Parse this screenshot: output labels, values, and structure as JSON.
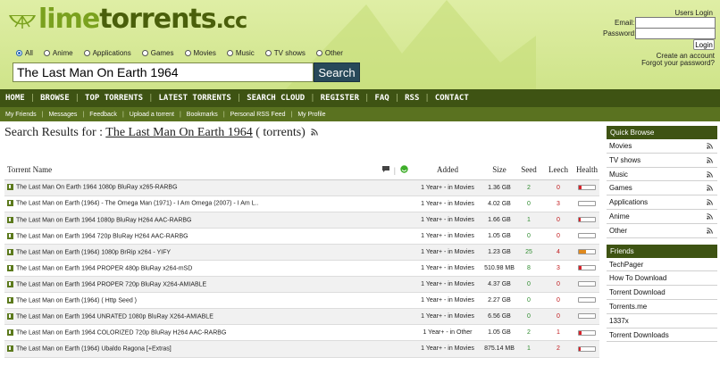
{
  "site": {
    "logo_lime": "lime",
    "logo_torrents": "torrents",
    "logo_tld": ".cc"
  },
  "colors": {
    "accent": "#3e5313",
    "header_bg": "#d9eb9c",
    "seed": "#2e8b2e",
    "leech": "#c0181b",
    "search_btn": "#28495a"
  },
  "categories": [
    {
      "label": "All",
      "checked": true
    },
    {
      "label": "Anime",
      "checked": false
    },
    {
      "label": "Applications",
      "checked": false
    },
    {
      "label": "Games",
      "checked": false
    },
    {
      "label": "Movies",
      "checked": false
    },
    {
      "label": "Music",
      "checked": false
    },
    {
      "label": "TV shows",
      "checked": false
    },
    {
      "label": "Other",
      "checked": false
    }
  ],
  "search": {
    "value": "The Last Man On Earth 1964",
    "button": "Search"
  },
  "login": {
    "users_login": "Users Login",
    "email_label": "Email:",
    "password_label": "Password:",
    "button": "Login",
    "create_account": "Create an account",
    "forgot": "Forgot your password?"
  },
  "nav": [
    "HOME",
    "BROWSE",
    "TOP TORRENTS",
    "LATEST TORRENTS",
    "SEARCH CLOUD",
    "REGISTER",
    "FAQ",
    "RSS",
    "CONTACT"
  ],
  "subnav": [
    "My Friends",
    "Messages",
    "Feedback",
    "Upload a torrent",
    "Bookmarks",
    "Personal RSS Feed",
    "My Profile"
  ],
  "results": {
    "prefix": "Search Results for : ",
    "query": "The Last Man On Earth 1964",
    "suffix": " ( torrents)"
  },
  "table": {
    "headers": {
      "name": "Torrent Name",
      "added": "Added",
      "size": "Size",
      "seed": "Seed",
      "leech": "Leech",
      "health": "Health"
    },
    "rows": [
      {
        "name": "The Last Man On Earth 1964 1080p BluRay x265-RARBG",
        "added": "1 Year+ - in Movies",
        "size": "1.36 GB",
        "seed": "2",
        "leech": "0",
        "health": 0.15,
        "health_color": "#d9232b"
      },
      {
        "name": "The Last Man on Earth (1964) - The Omega Man (1971) - I Am Omega (2007) - I Am L..",
        "added": "1 Year+ - in Movies",
        "size": "4.02 GB",
        "seed": "0",
        "leech": "3",
        "health": 0,
        "health_color": "#d9232b"
      },
      {
        "name": "The Last Man on Earth 1964 1080p BluRay H264 AAC-RARBG",
        "added": "1 Year+ - in Movies",
        "size": "1.66 GB",
        "seed": "1",
        "leech": "0",
        "health": 0.1,
        "health_color": "#d9232b"
      },
      {
        "name": "The Last Man on Earth 1964 720p BluRay H264 AAC-RARBG",
        "added": "1 Year+ - in Movies",
        "size": "1.05 GB",
        "seed": "0",
        "leech": "0",
        "health": 0,
        "health_color": "#d9232b"
      },
      {
        "name": "The Last Man on Earth (1964) 1080p BrRip x264 - YIFY",
        "added": "1 Year+ - in Movies",
        "size": "1.23 GB",
        "seed": "25",
        "leech": "4",
        "health": 0.45,
        "health_color": "#e08a1e"
      },
      {
        "name": "The Last Man on Earth 1964 PROPER 480p BluRay x264-mSD",
        "added": "1 Year+ - in Movies",
        "size": "510.98 MB",
        "seed": "8",
        "leech": "3",
        "health": 0.15,
        "health_color": "#d9232b"
      },
      {
        "name": "The Last Man on Earth 1964 PROPER 720p BluRay X264-AMIABLE",
        "added": "1 Year+ - in Movies",
        "size": "4.37 GB",
        "seed": "0",
        "leech": "0",
        "health": 0,
        "health_color": "#d9232b"
      },
      {
        "name": "The Last Man on Earth (1964) ( Http Seed )",
        "added": "1 Year+ - in Movies",
        "size": "2.27 GB",
        "seed": "0",
        "leech": "0",
        "health": 0,
        "health_color": "#d9232b"
      },
      {
        "name": "The Last Man on Earth 1964 UNRATED 1080p BluRay X264-AMIABLE",
        "added": "1 Year+ - in Movies",
        "size": "6.56 GB",
        "seed": "0",
        "leech": "0",
        "health": 0,
        "health_color": "#d9232b"
      },
      {
        "name": "The Last Man on Earth 1964 COLORIZED 720p BluRay H264 AAC-RARBG",
        "added": "1 Year+ - in Other",
        "size": "1.05 GB",
        "seed": "2",
        "leech": "1",
        "health": 0.15,
        "health_color": "#d9232b"
      },
      {
        "name": "The Last Man on Earth (1964) Ubaldo Ragona [+Extras]",
        "added": "1 Year+ - in Movies",
        "size": "875.14 MB",
        "seed": "1",
        "leech": "2",
        "health": 0.1,
        "health_color": "#d9232b"
      }
    ]
  },
  "quick_browse": {
    "title": "Quick Browse",
    "items": [
      "Movies",
      "TV shows",
      "Music",
      "Games",
      "Applications",
      "Anime",
      "Other"
    ]
  },
  "friends": {
    "title": "Friends",
    "items": [
      "TechPager",
      "How To Download",
      "Torrent Download",
      "Torrents.me",
      "1337x",
      "Torrent Downloads"
    ]
  }
}
